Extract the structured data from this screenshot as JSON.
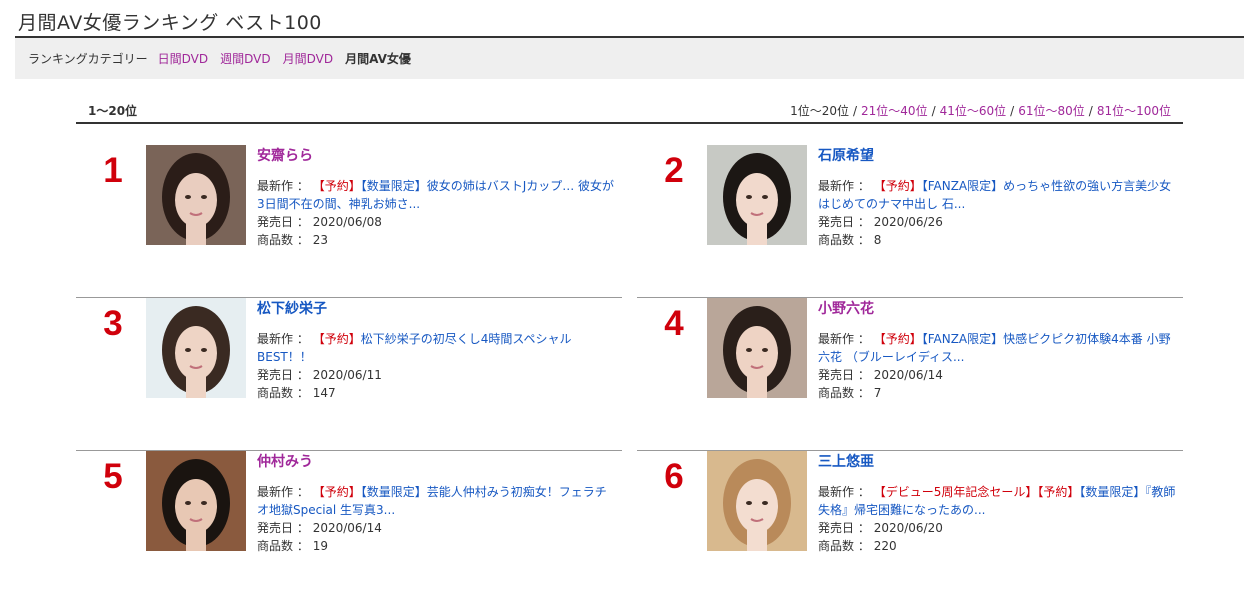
{
  "page": {
    "title": "月間AV女優ランキング ベスト100"
  },
  "category_bar": {
    "label": "ランキングカテゴリー",
    "links": [
      "日間DVD",
      "週間DVD",
      "月間DVD"
    ],
    "current": "月間AV女優"
  },
  "range": {
    "current_label": "1〜20位",
    "pager_current": "1位〜20位",
    "pager_links": [
      "21位〜40位",
      "41位〜60位",
      "61位〜80位",
      "81位〜100位"
    ],
    "separator": "/"
  },
  "labels": {
    "latest": "最新作",
    "release": "発売日",
    "count": "商品数",
    "colon": "："
  },
  "actresses": [
    {
      "rank": "1",
      "name": "安齋らら",
      "name_color": "#a0289a",
      "tags": [
        "【予約】"
      ],
      "title": "【数量限定】彼女の姉はバストJカップ… 彼女が3日間不在の間、神乳お姉さ...",
      "release": "2020/06/08",
      "count": "23"
    },
    {
      "rank": "2",
      "name": "石原希望",
      "name_color": "#1758c2",
      "tags": [
        "【予約】"
      ],
      "title": "【FANZA限定】めっちゃ性欲の強い方言美少女 はじめてのナマ中出し 石...",
      "release": "2020/06/26",
      "count": "8"
    },
    {
      "rank": "3",
      "name": "松下紗栄子",
      "name_color": "#1758c2",
      "tags": [
        "【予約】"
      ],
      "title": "松下紗栄子の初尽くし4時間スペシャルBEST！！",
      "release": "2020/06/11",
      "count": "147"
    },
    {
      "rank": "4",
      "name": "小野六花",
      "name_color": "#a0289a",
      "tags": [
        "【予約】"
      ],
      "title": "【FANZA限定】快感ピクピク初体験4本番 小野六花 （ブルーレイディス...",
      "release": "2020/06/14",
      "count": "7"
    },
    {
      "rank": "5",
      "name": "仲村みう",
      "name_color": "#a0289a",
      "tags": [
        "【予約】"
      ],
      "title": "【数量限定】芸能人仲村みう初痴女！フェラチオ地獄Special 生写真3...",
      "release": "2020/06/14",
      "count": "19"
    },
    {
      "rank": "6",
      "name": "三上悠亜",
      "name_color": "#1758c2",
      "tags": [
        "【デビュー5周年記念セール】",
        "【予約】"
      ],
      "title": "【数量限定】『教師失格』帰宅困難になったあの...",
      "release": "2020/06/20",
      "count": "220"
    }
  ],
  "colors": {
    "link_purple": "#a0289a",
    "link_blue": "#1758c2",
    "rank_red": "#d0000b",
    "tag_red": "#d0000b"
  }
}
